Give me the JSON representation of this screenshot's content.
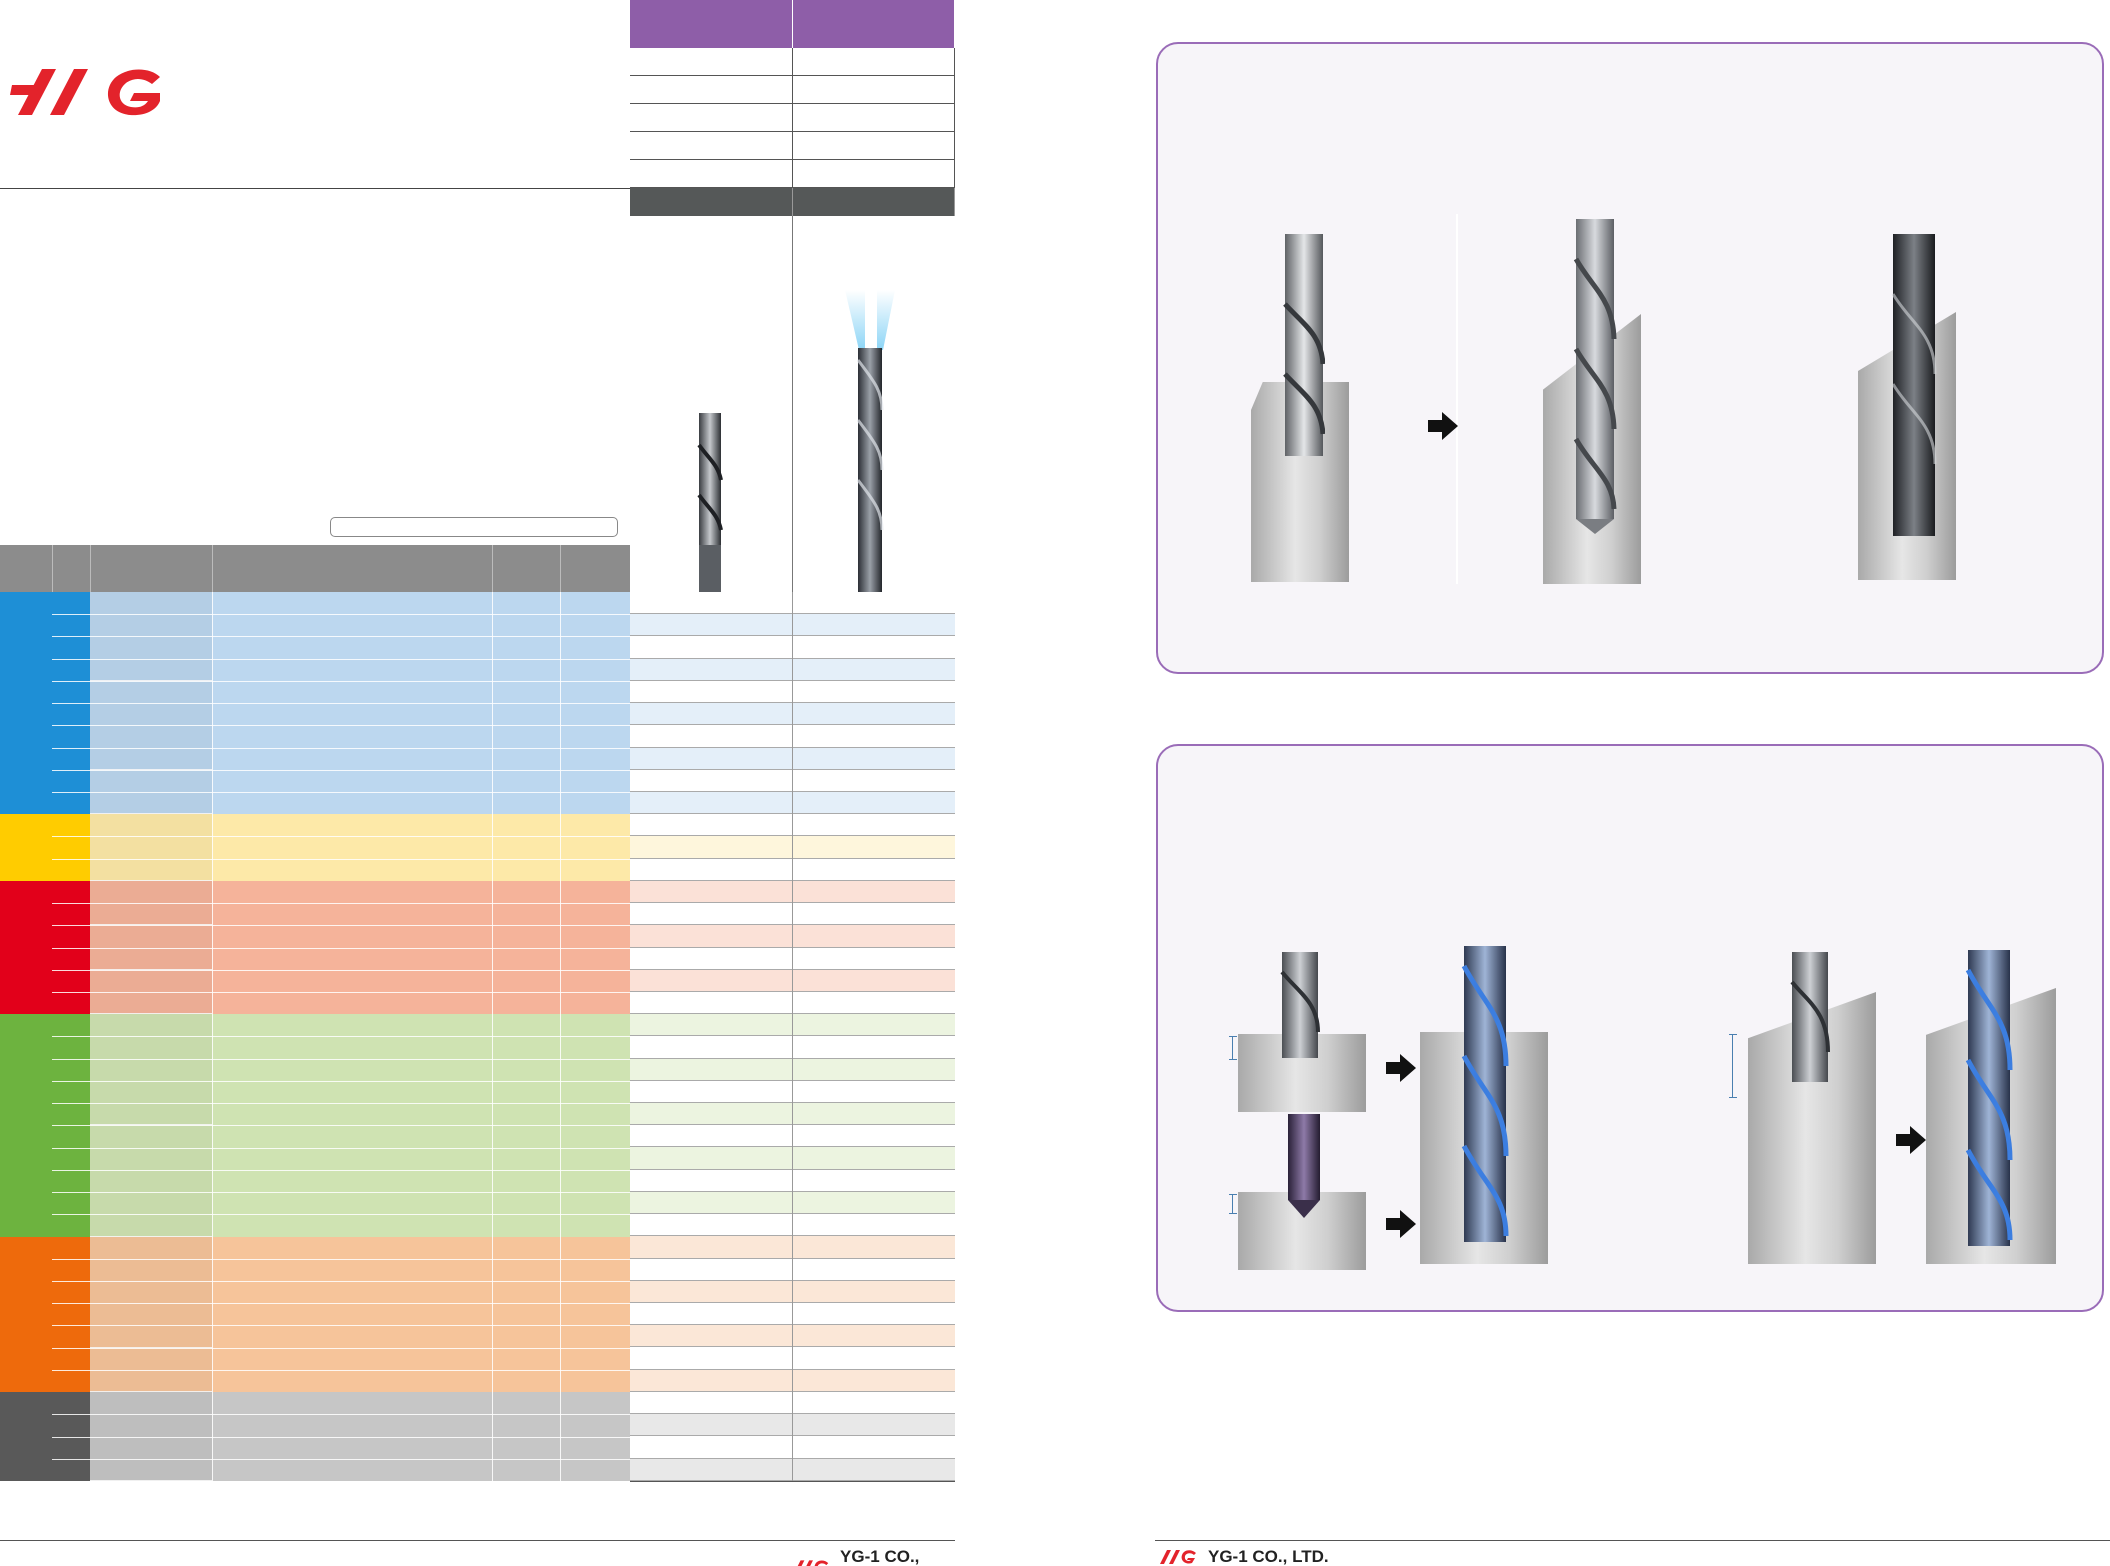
{
  "brand": {
    "footer_text": "YG-1 CO., LTD.",
    "logo_color": "#e3232b"
  },
  "colors": {
    "header_purple": "#8e5ea8",
    "header_dark": "#555858",
    "table_head_gray": "#8c8c8c",
    "panel_border": "#9a6cb8",
    "groups": [
      "#1e8fd6",
      "#ffcc00",
      "#e2001a",
      "#6db33f",
      "#ee6a0c",
      "#595959"
    ]
  },
  "material_groups": [
    {
      "id": "P",
      "color": "#1e8fd6",
      "light": "#bcd7ef",
      "rows": 10,
      "subs": [
        4,
        4,
        2
      ]
    },
    {
      "id": "M",
      "color": "#ffcc00",
      "light": "#fde9a8",
      "rows": 3,
      "subs": [
        3
      ]
    },
    {
      "id": "K",
      "color": "#e2001a",
      "light": "#f5b39a",
      "rows": 6,
      "subs": [
        2,
        2,
        2
      ]
    },
    {
      "id": "N",
      "color": "#6db33f",
      "light": "#cfe3b2",
      "rows": 10,
      "subs": [
        5,
        5
      ]
    },
    {
      "id": "S",
      "color": "#ee6a0c",
      "light": "#f6c49a",
      "rows": 7,
      "subs": [
        5,
        2
      ]
    },
    {
      "id": "H",
      "color": "#595959",
      "light": "#c6c6c6",
      "rows": 4,
      "subs": [
        4
      ]
    }
  ]
}
